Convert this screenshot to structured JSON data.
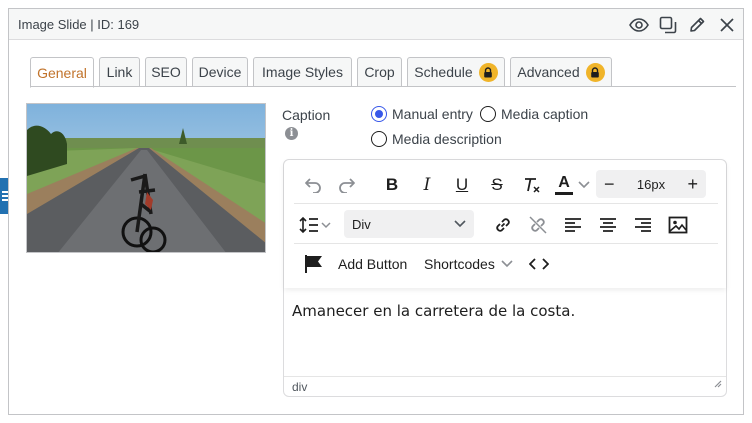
{
  "window": {
    "title": "Image Slide | ID: 169",
    "icons": [
      "eye-icon",
      "duplicate-icon",
      "pencil-icon",
      "close-icon"
    ]
  },
  "tabs": [
    {
      "label": "General",
      "active": true
    },
    {
      "label": "Link"
    },
    {
      "label": "SEO"
    },
    {
      "label": "Device"
    },
    {
      "label": "Image Styles"
    },
    {
      "label": "Crop"
    },
    {
      "label": "Schedule",
      "locked": true
    },
    {
      "label": "Advanced",
      "locked": true
    }
  ],
  "caption": {
    "label": "Caption",
    "options": [
      {
        "label": "Manual entry",
        "selected": true
      },
      {
        "label": "Media caption",
        "selected": false
      },
      {
        "label": "Media description",
        "selected": false
      }
    ]
  },
  "editor": {
    "font_size": "16px",
    "block_type": "Div",
    "add_button_label": "Add Button",
    "shortcodes_label": "Shortcodes",
    "content": "Amanecer en la carretera de la costa.",
    "path": "div"
  },
  "colors": {
    "active_tab": "#c1732b",
    "lock_badge": "#f0b429",
    "radio_selected": "#3858e9",
    "side_handle": "#2271b1"
  }
}
